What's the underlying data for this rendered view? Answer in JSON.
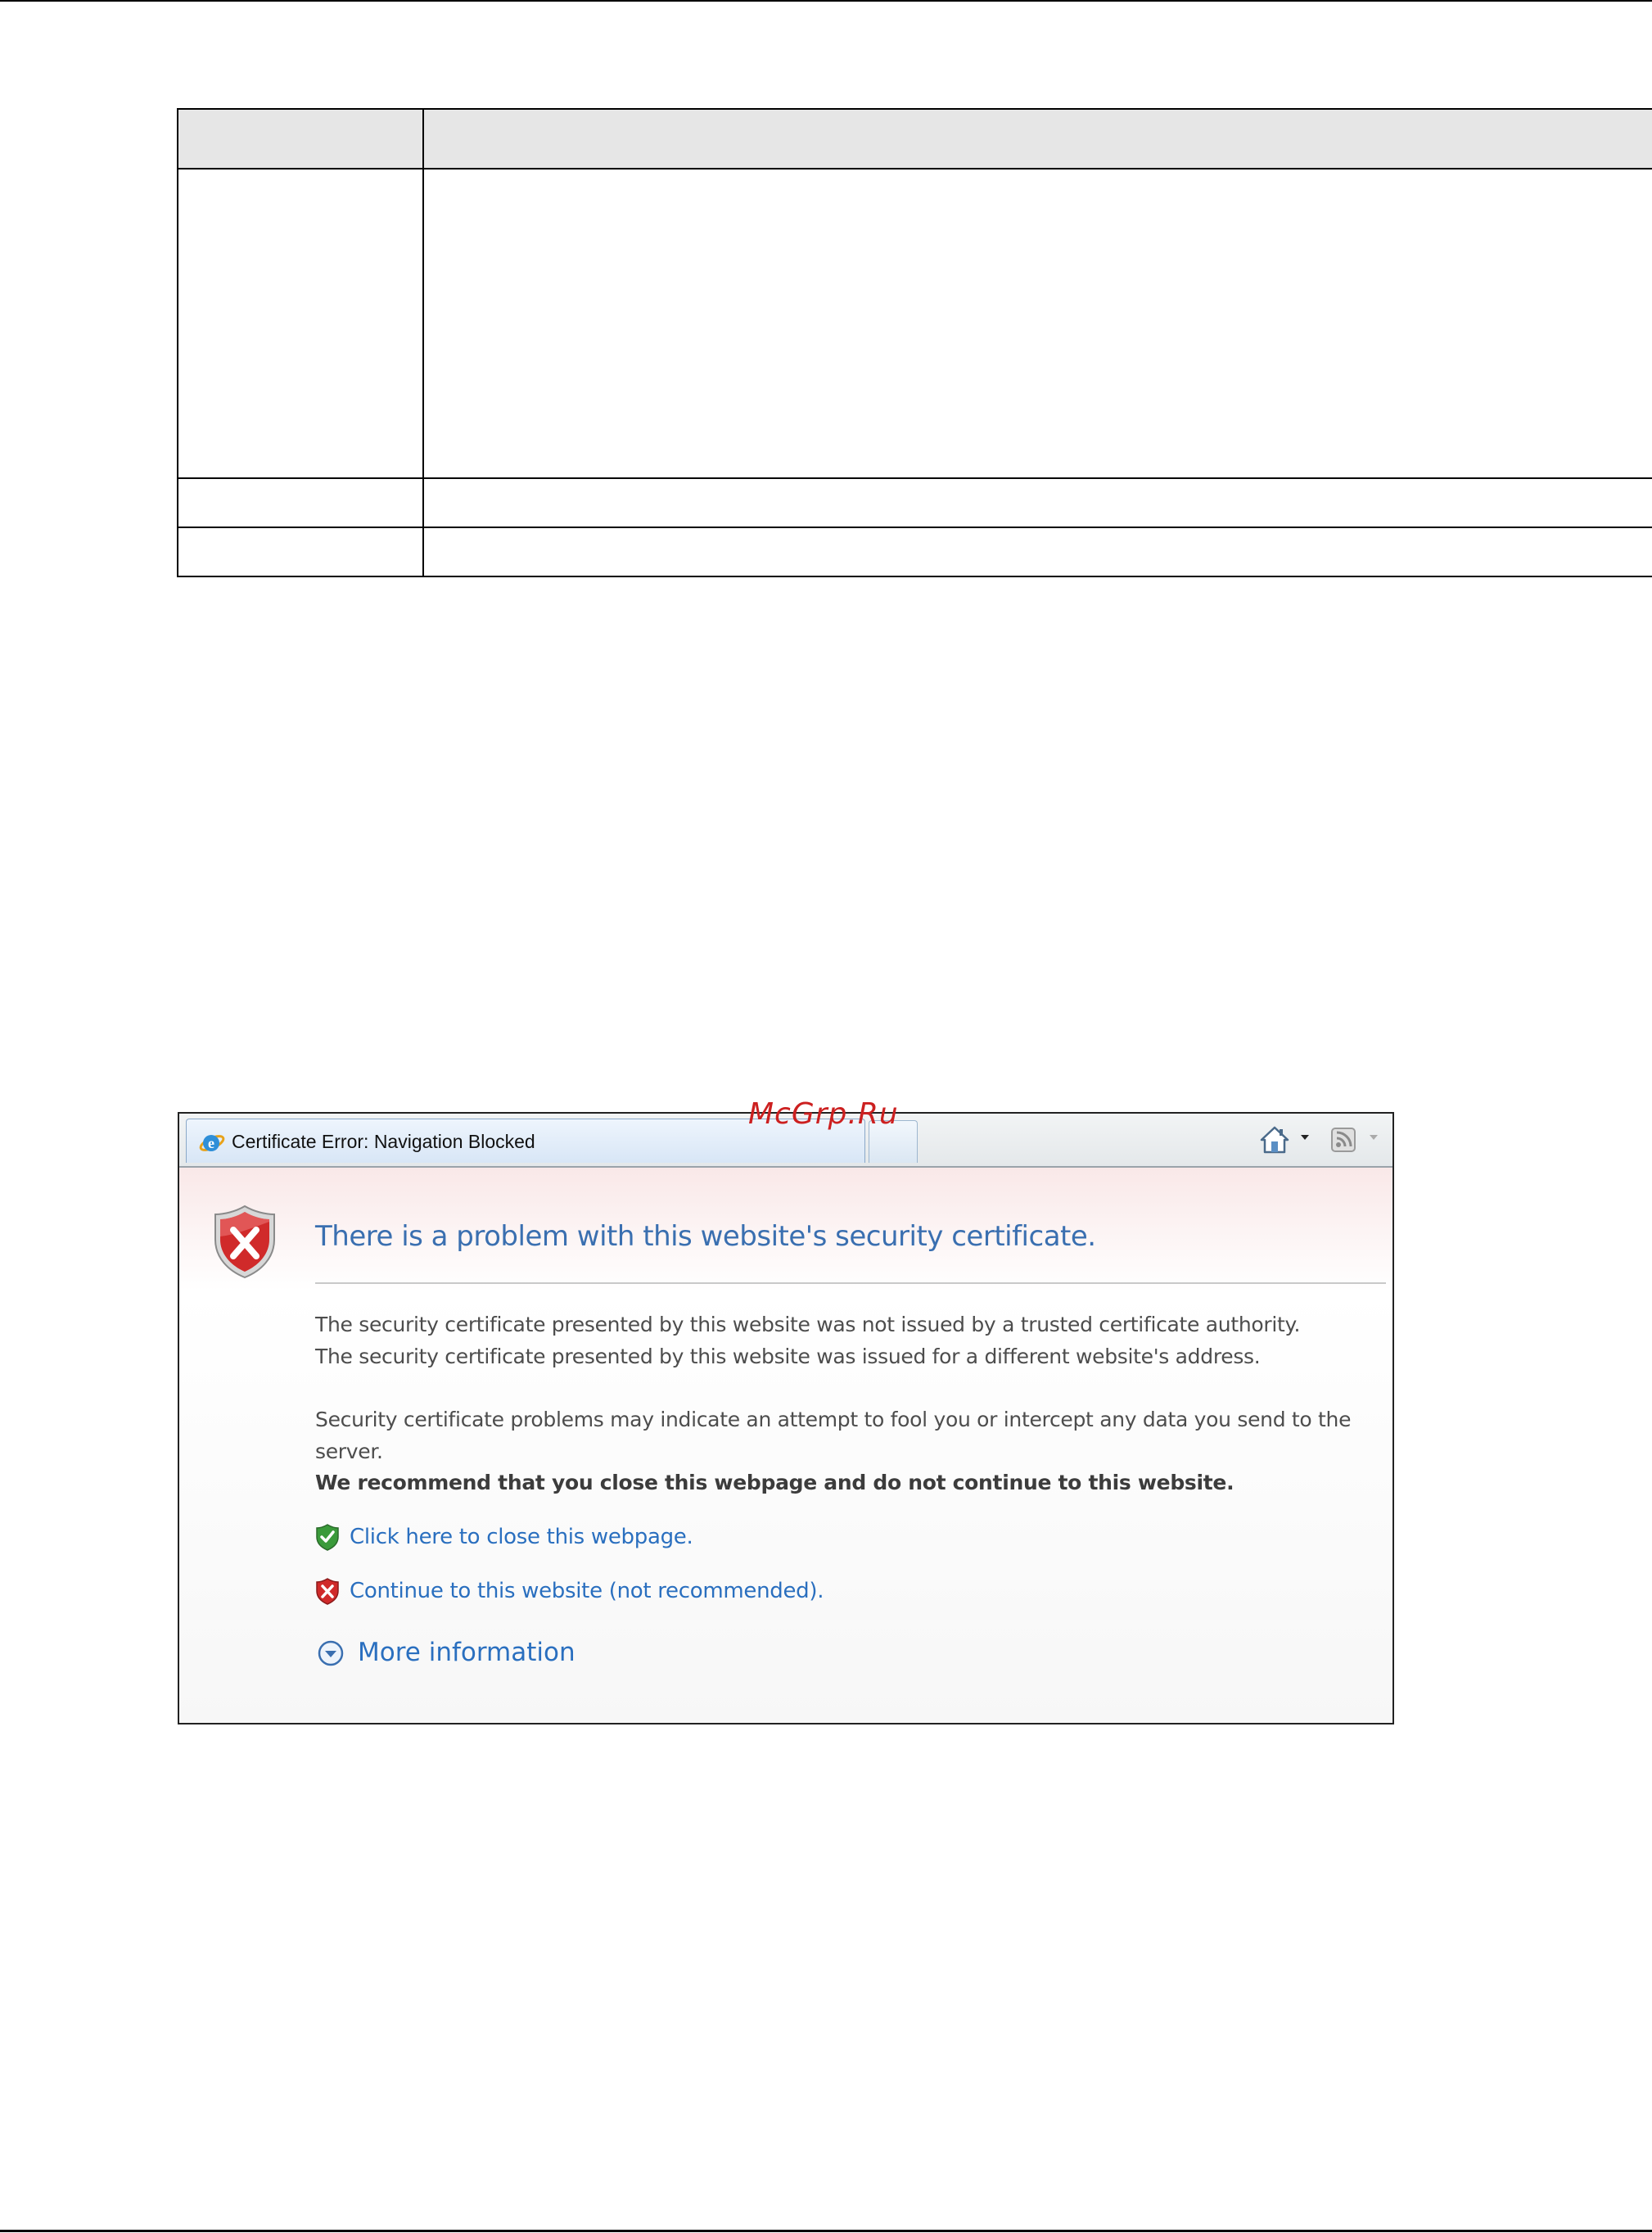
{
  "table": {
    "header": [
      "",
      ""
    ],
    "rows": [
      [
        "",
        ""
      ],
      [
        "",
        ""
      ],
      [
        "",
        ""
      ]
    ]
  },
  "browser": {
    "tab_title": "Certificate Error: Navigation Blocked",
    "toolbar_icons": [
      "home-icon",
      "feeds-icon"
    ]
  },
  "error_page": {
    "title": "There is a problem with this website's security certificate.",
    "paragraph1_line1": "The security certificate presented by this website was not issued by a trusted certificate authority.",
    "paragraph1_line2": "The security certificate presented by this website was issued for a different website's address.",
    "paragraph2": "Security certificate problems may indicate an attempt to fool you or intercept any data you send to the server.",
    "recommendation": "We recommend that you close this webpage and do not continue to this website.",
    "close_link": "Click here to close this webpage.",
    "continue_link": "Continue to this website (not recommended).",
    "more_info": "More information"
  },
  "watermark": "McGrp.Ru",
  "colors": {
    "link": "#2a6fbf",
    "title": "#3a6fb0",
    "error_red": "#cc2020",
    "safe_green": "#3a9a3a"
  }
}
